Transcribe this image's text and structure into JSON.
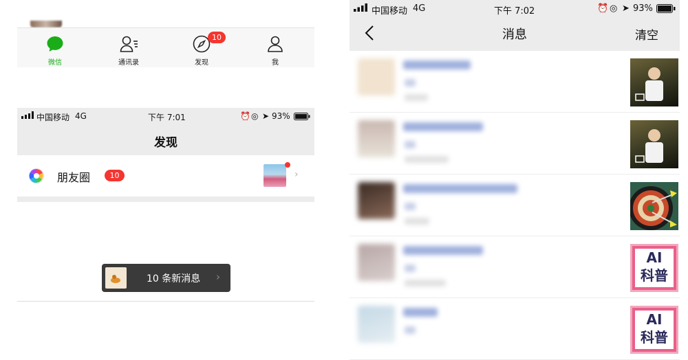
{
  "tabbar": {
    "tabs": [
      {
        "label": "微信",
        "icon": "chat-bubble-icon",
        "active": true
      },
      {
        "label": "通讯录",
        "icon": "contacts-icon",
        "active": false
      },
      {
        "label": "发现",
        "icon": "compass-icon",
        "active": false,
        "badge": "10"
      },
      {
        "label": "我",
        "icon": "person-icon",
        "active": false
      }
    ]
  },
  "discover": {
    "status": {
      "carrier": "中国移动",
      "network": "4G",
      "time": "下午 7:01",
      "battery": "93%"
    },
    "title": "发现",
    "moments": {
      "label": "朋友圈",
      "badge": "10"
    },
    "toast": {
      "text": "10 条新消息"
    }
  },
  "messages": {
    "status": {
      "carrier": "中国移动",
      "network": "4G",
      "time": "下午 7:02",
      "battery": "93%"
    },
    "title": "消息",
    "clear_label": "清空",
    "items": [
      {
        "thumb": "photo-person"
      },
      {
        "thumb": "photo-person"
      },
      {
        "thumb": "photo-darts"
      },
      {
        "thumb": "ai-poster"
      },
      {
        "thumb": "ai-poster"
      }
    ],
    "poster_text": {
      "line1": "AI",
      "line2": "科普"
    }
  },
  "colors": {
    "accent_green": "#1aad19",
    "badge_red": "#f43530",
    "bar_gray": "#ececec"
  }
}
